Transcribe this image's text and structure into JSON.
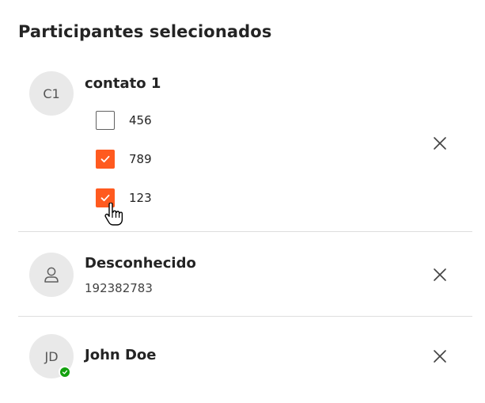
{
  "header": {
    "title": "Participantes selecionados"
  },
  "participants": [
    {
      "avatar_text": "C1",
      "name": "contato 1",
      "numbers": [
        {
          "label": "456",
          "checked": false
        },
        {
          "label": "789",
          "checked": true
        },
        {
          "label": "123",
          "checked": true
        }
      ],
      "remove_icon": "close-icon"
    },
    {
      "avatar_icon": "person-icon",
      "name": "Desconhecido",
      "phone": "192382783",
      "remove_icon": "close-icon"
    },
    {
      "avatar_text": "JD",
      "name": "John Doe",
      "presence": "available",
      "remove_icon": "close-icon"
    }
  ],
  "colors": {
    "checkbox_checked": "#ff5a1f",
    "presence_available": "#13a10e",
    "avatar_bg": "#e9e9e9",
    "divider": "#dedede"
  }
}
